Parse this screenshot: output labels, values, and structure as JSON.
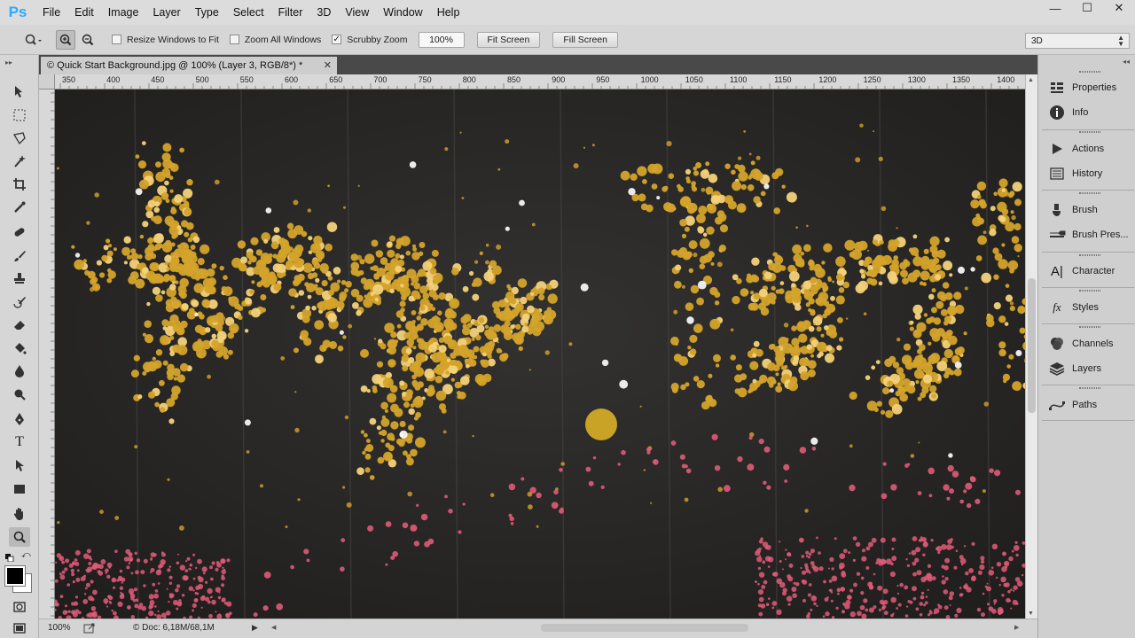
{
  "app": {
    "logo": "Ps"
  },
  "menu": [
    "File",
    "Edit",
    "Image",
    "Layer",
    "Type",
    "Select",
    "Filter",
    "3D",
    "View",
    "Window",
    "Help"
  ],
  "window_controls": {
    "minimize": "—",
    "maximize": "☐",
    "close": "✕"
  },
  "options": {
    "resize_windows_label": "Resize Windows to Fit",
    "resize_windows_checked": false,
    "zoom_all_label": "Zoom All Windows",
    "zoom_all_checked": false,
    "scrubby_label": "Scrubby Zoom",
    "scrubby_checked": true,
    "zoom_value": "100%",
    "fit_screen": "Fit Screen",
    "fill_screen": "Fill Screen",
    "workspace": "3D"
  },
  "document": {
    "tab_title": "© Quick Start Background.jpg @ 100% (Layer 3, RGB/8*) *",
    "close": "✕"
  },
  "ruler": {
    "labels": [
      "350",
      "400",
      "450",
      "500",
      "550",
      "600",
      "650",
      "700",
      "750",
      "800",
      "850",
      "900",
      "950",
      "1000",
      "1050",
      "1100",
      "1150",
      "1200",
      "1250",
      "1300",
      "1350",
      "1400"
    ]
  },
  "status": {
    "zoom": "100%",
    "doc": "Doc: 6,18M/68,1M"
  },
  "panels": [
    "Properties",
    "Info",
    "Actions",
    "History",
    "Brush",
    "Brush Pres...",
    "Character",
    "Styles",
    "Channels",
    "Layers",
    "Paths"
  ],
  "colors": {
    "gold": "#d4a32a",
    "pink": "#e05a79",
    "canvas_bg": "#2b2a28",
    "accent": "#31a8ff"
  }
}
